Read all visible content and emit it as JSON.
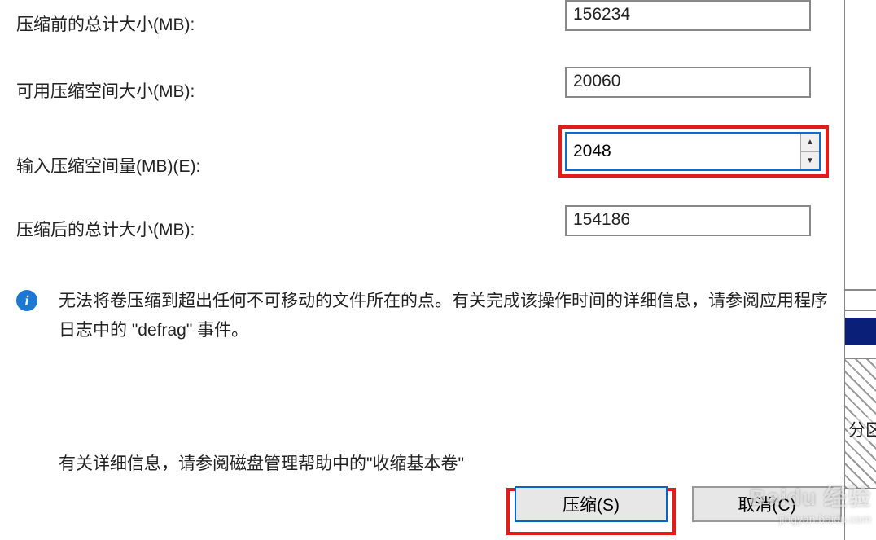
{
  "labels": {
    "total_before": "压缩前的总计大小(MB):",
    "available": "可用压缩空间大小(MB):",
    "input_amount": "输入压缩空间量(MB)(E):",
    "total_after": "压缩后的总计大小(MB):"
  },
  "values": {
    "total_before": "156234",
    "available": "20060",
    "input_amount": "2048",
    "total_after": "154186"
  },
  "info_text": "无法将卷压缩到超出任何不可移动的文件所在的点。有关完成该操作时间的详细信息，请参阅应用程序日志中的 \"defrag\" 事件。",
  "help_text": "有关详细信息，请参阅磁盘管理帮助中的\"收缩基本卷\"",
  "buttons": {
    "shrink": "压缩(S)",
    "cancel": "取消(C)"
  },
  "side": {
    "partition_label": "分区"
  },
  "watermark": {
    "brand": "Baidu 经验",
    "url": "jingyan.baidu.com"
  }
}
